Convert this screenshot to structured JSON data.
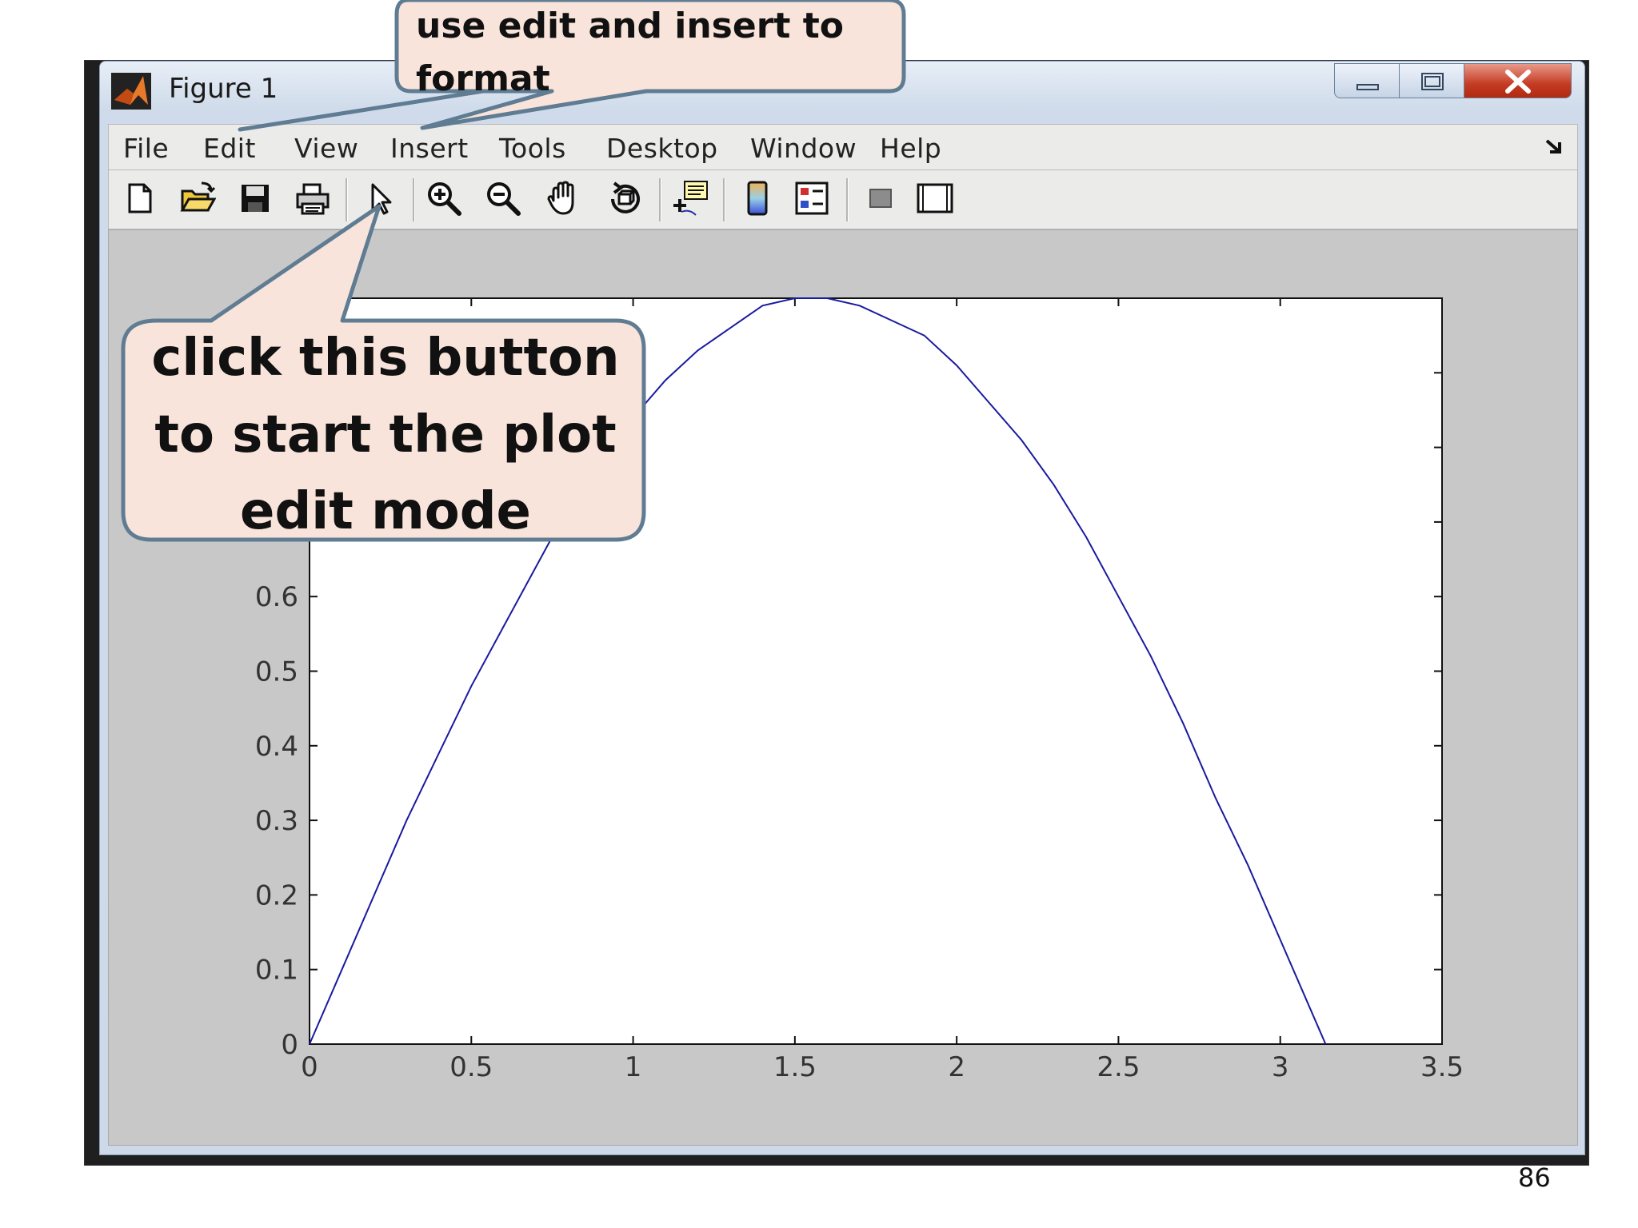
{
  "window": {
    "title": "Figure 1",
    "controls": [
      "minimize-icon",
      "maximize-icon",
      "close-icon"
    ]
  },
  "menubar": {
    "items": [
      "File",
      "Edit",
      "View",
      "Insert",
      "Tools",
      "Desktop",
      "Window",
      "Help"
    ]
  },
  "toolbar": {
    "buttons": [
      "new-figure-icon",
      "open-file-icon",
      "save-icon",
      "print-icon",
      "edit-plot-arrow-icon",
      "zoom-in-icon",
      "zoom-out-icon",
      "pan-hand-icon",
      "rotate-3d-icon",
      "data-cursor-icon",
      "colorbar-icon",
      "legend-icon",
      "hide-plot-tools-icon",
      "show-plot-tools-icon"
    ]
  },
  "chart_data": {
    "type": "line",
    "title": "",
    "xlabel": "",
    "ylabel": "",
    "xlim": [
      0,
      3.5
    ],
    "ylim": [
      0,
      1
    ],
    "xticks": [
      "0",
      "0.5",
      "1",
      "1.5",
      "2",
      "2.5",
      "3",
      "3.5"
    ],
    "yticks_visible": [
      "0",
      "0.1",
      "0.2",
      "0.3",
      "0.4",
      "0.5",
      "0.6"
    ],
    "grid": false,
    "series": [
      {
        "color": "#1a1aa0",
        "x": [
          0,
          0.1,
          0.2,
          0.3,
          0.4,
          0.5,
          0.6,
          0.7,
          0.8,
          0.9,
          1.0,
          1.1,
          1.2,
          1.3,
          1.4,
          1.5,
          1.571,
          1.6,
          1.7,
          1.8,
          1.9,
          2.0,
          2.1,
          2.2,
          2.3,
          2.4,
          2.5,
          2.6,
          2.7,
          2.8,
          2.9,
          3.0,
          3.1,
          3.14
        ],
        "y": [
          0,
          0.1,
          0.2,
          0.3,
          0.39,
          0.48,
          0.56,
          0.64,
          0.72,
          0.78,
          0.84,
          0.89,
          0.93,
          0.96,
          0.99,
          1.0,
          1.0,
          1.0,
          0.99,
          0.97,
          0.95,
          0.91,
          0.86,
          0.81,
          0.75,
          0.68,
          0.6,
          0.52,
          0.43,
          0.33,
          0.24,
          0.14,
          0.04,
          0.0
        ]
      }
    ]
  },
  "callouts": {
    "top": "use edit and insert to format",
    "bottom": "click this button to start the plot edit mode"
  },
  "slide": {
    "page_number": "86"
  }
}
